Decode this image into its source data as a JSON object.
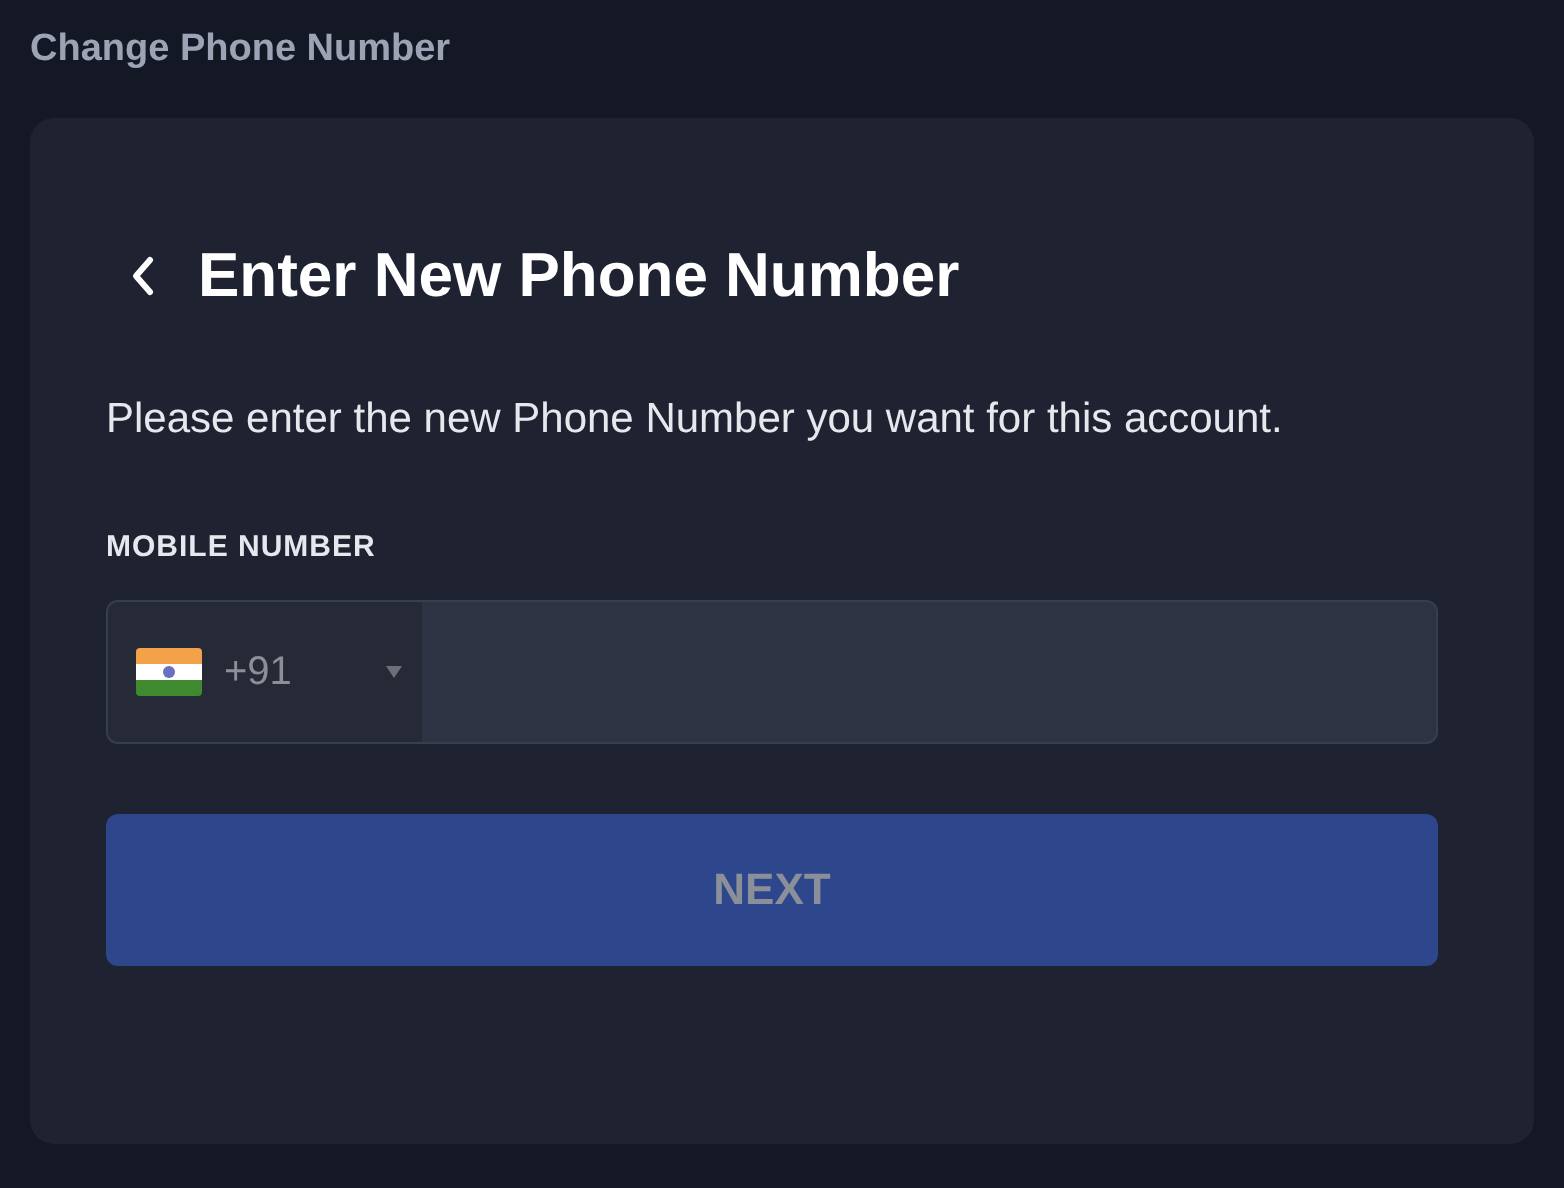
{
  "page_title": "Change Phone Number",
  "card": {
    "heading": "Enter New Phone Number",
    "description": "Please enter the new Phone Number you want for this account.",
    "field_label": "MOBILE NUMBER",
    "phone": {
      "country_code": "+91"
    },
    "next_button": {
      "label": "NEXT",
      "disabled": true
    }
  }
}
